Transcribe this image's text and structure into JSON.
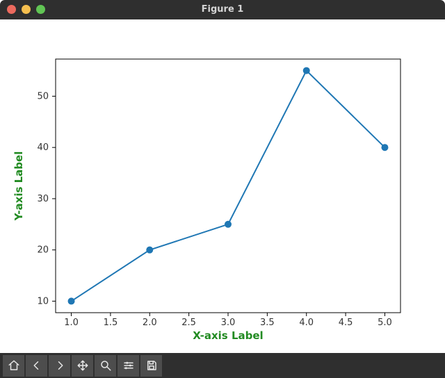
{
  "window": {
    "title": "Figure 1"
  },
  "toolbar": {
    "home": "Home",
    "back": "Back",
    "forward": "Forward",
    "pan": "Pan",
    "zoom": "Zoom",
    "configure": "Configure subplots",
    "save": "Save"
  },
  "chart_data": {
    "type": "line",
    "x": [
      1.0,
      2.0,
      3.0,
      4.0,
      5.0
    ],
    "y": [
      10,
      20,
      25,
      55,
      40
    ],
    "xlabel": "X-axis Label",
    "ylabel": "Y-axis Label",
    "x_ticks": [
      1.0,
      1.5,
      2.0,
      2.5,
      3.0,
      3.5,
      4.0,
      4.5,
      5.0
    ],
    "y_ticks": [
      10,
      20,
      30,
      40,
      50
    ],
    "xlim": [
      0.8,
      5.2
    ],
    "ylim": [
      7.75,
      57.25
    ],
    "marker": "o",
    "line_color": "#1f77b4"
  }
}
